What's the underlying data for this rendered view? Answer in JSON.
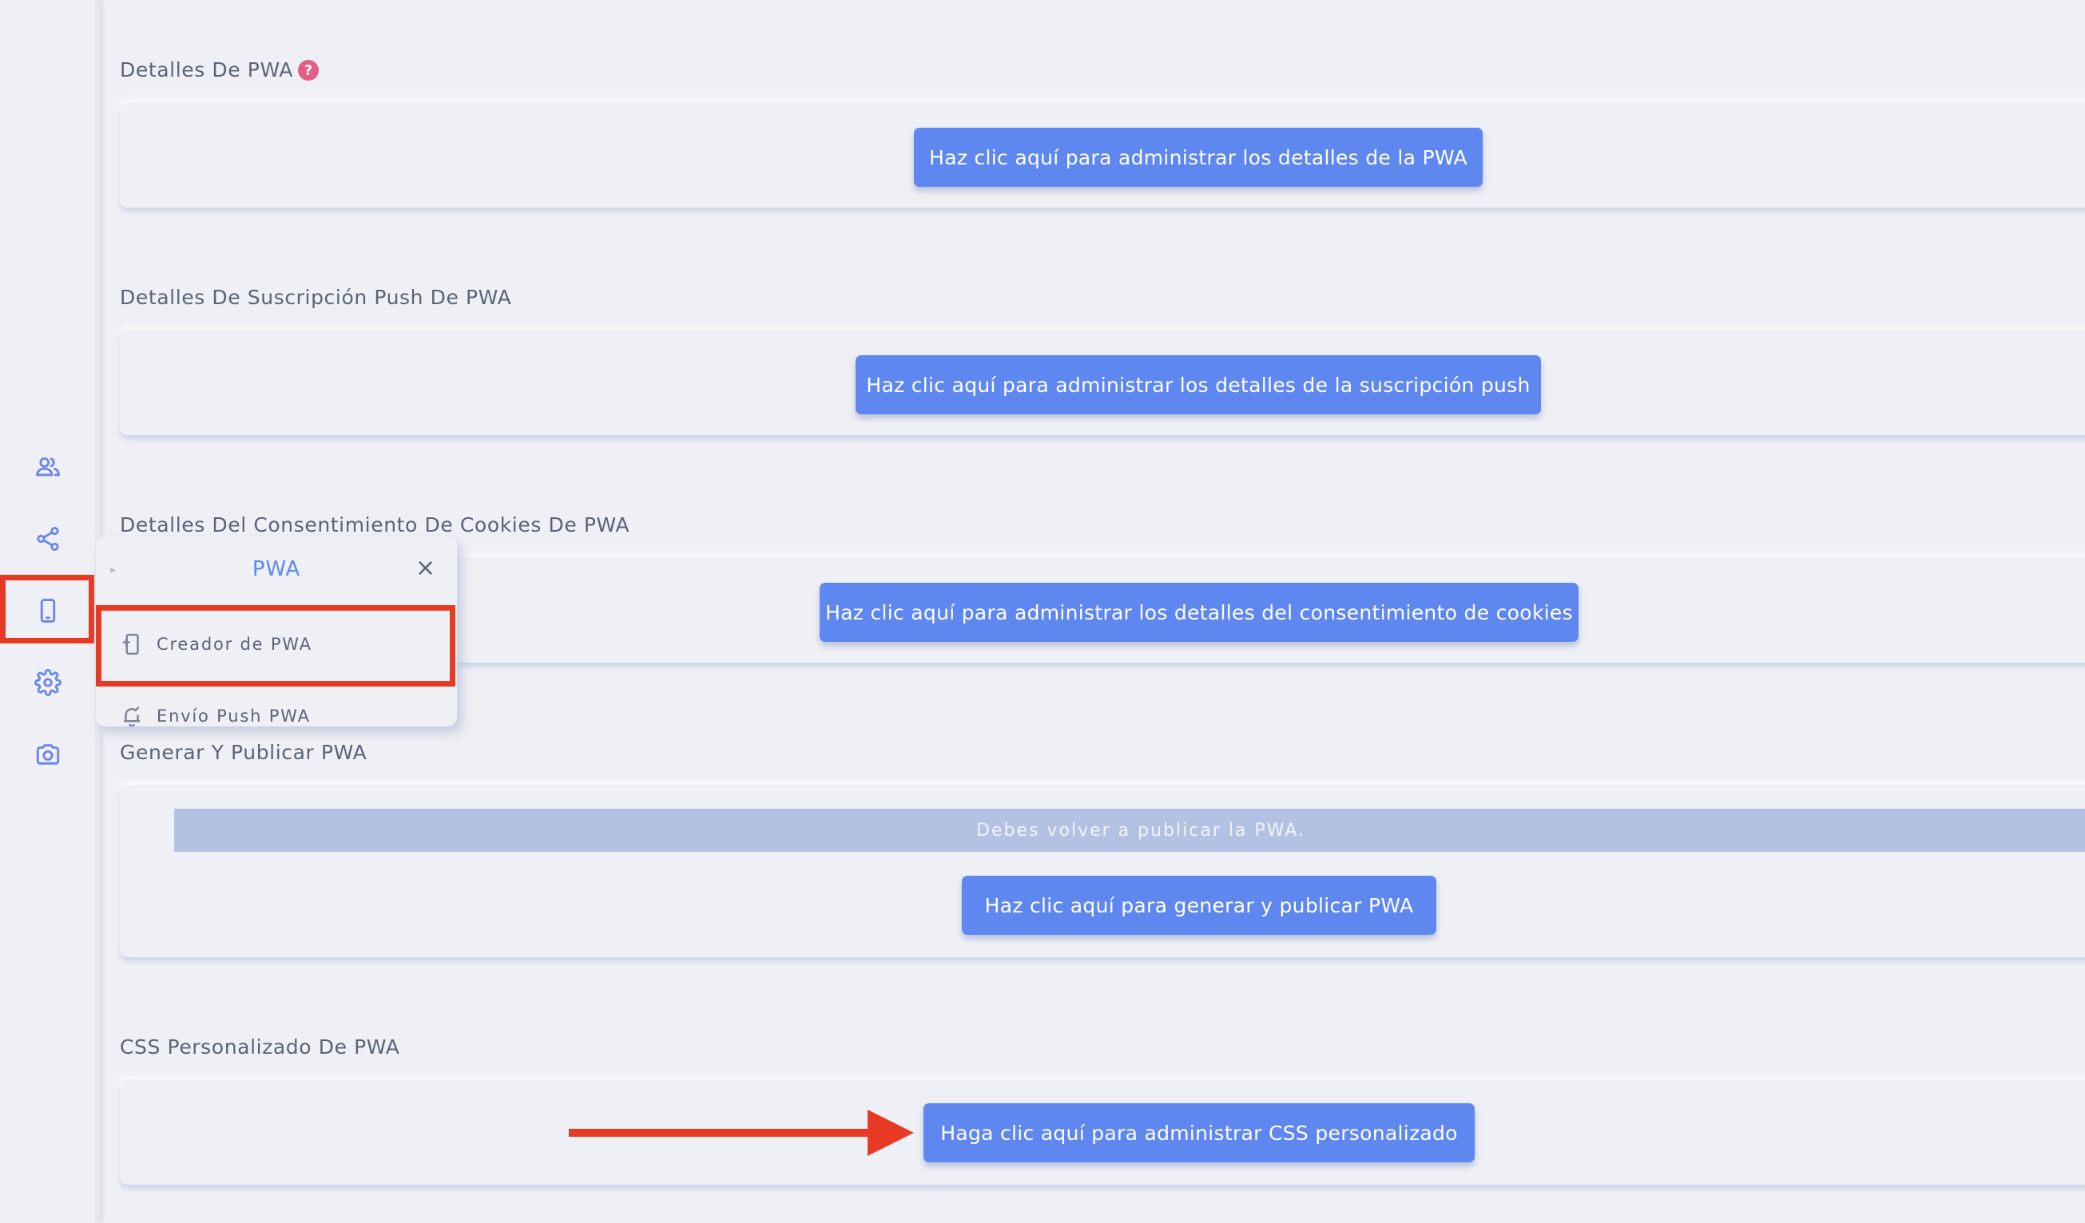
{
  "sidebar": {
    "icons": [
      "users-icon",
      "share-icon",
      "mobile-icon",
      "gear-icon",
      "camera-icon"
    ],
    "accent_color": "#6a86e6"
  },
  "sections": {
    "pwa_details": {
      "title": "Detalles De PWA",
      "help": "?",
      "button": "Haz clic aquí para administrar los detalles de la PWA"
    },
    "push_details": {
      "title": "Detalles De Suscripción Push De PWA",
      "button": "Haz clic aquí para administrar los detalles de la suscripción push"
    },
    "cookie_details": {
      "title": "Detalles Del Consentimiento De Cookies De PWA",
      "button": "Haz clic aquí para administrar los detalles del consentimiento de cookies"
    },
    "publish": {
      "title": "Generar Y Publicar PWA",
      "notice": "Debes volver a publicar la PWA.",
      "button": "Haz clic aquí para generar y publicar PWA"
    },
    "custom_css": {
      "title": "CSS Personalizado De PWA",
      "button": "Haga clic aquí para administrar CSS personalizado"
    }
  },
  "popup": {
    "title": "PWA",
    "close": "×",
    "items": [
      {
        "label": "Creador de PWA",
        "icon": "mobile-builder-icon"
      },
      {
        "label": "Envío Push PWA",
        "icon": "bell-icon"
      }
    ]
  },
  "colors": {
    "background": "#eff0f5",
    "button": "#5f87f0",
    "annotation": "#e63a24",
    "notice": "#b3c1e3",
    "help": "#e45d85"
  }
}
